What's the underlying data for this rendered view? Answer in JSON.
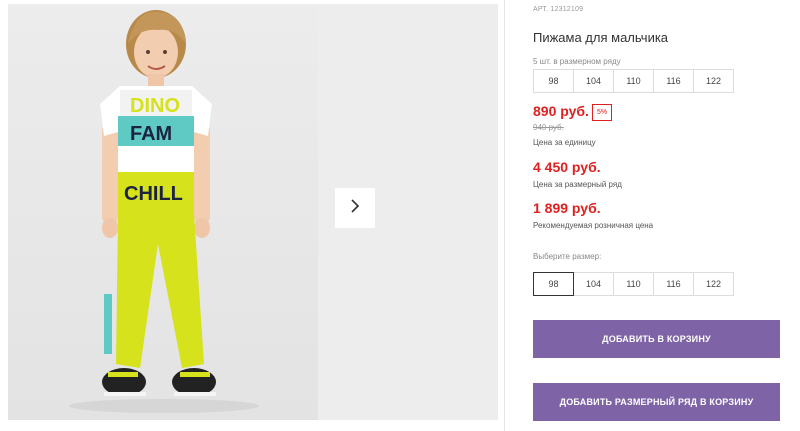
{
  "product": {
    "sku": "АРТ. 12312109",
    "title": "Пижама для мальчика",
    "row_note": "5 шт. в размерном ряду",
    "row_sizes": [
      "98",
      "104",
      "110",
      "116",
      "122"
    ]
  },
  "pricing": {
    "unit_price": "890 руб.",
    "discount": "5%",
    "old_price": "940 руб.",
    "unit_label": "Цена за единицу",
    "row_price": "4 450 руб.",
    "row_label": "Цена за размерный ряд",
    "retail_price": "1 899 руб.",
    "retail_label": "Рекомендуемая розничная цена"
  },
  "size_select": {
    "label": "Выберите размер:",
    "options": [
      "98",
      "104",
      "110",
      "116",
      "122"
    ],
    "selected": "98"
  },
  "buttons": {
    "add_to_cart": "ДОБАВИТЬ В КОРЗИНУ",
    "add_row_to_cart": "ДОБАВИТЬ РАЗМЕРНЫЙ РЯД В КОРЗИНУ"
  },
  "colors": {
    "price_red": "#e02020",
    "button_purple": "#7e64a6",
    "pants_yellow": "#d5e21c"
  },
  "icons": {
    "next": "chevron-right-icon"
  }
}
